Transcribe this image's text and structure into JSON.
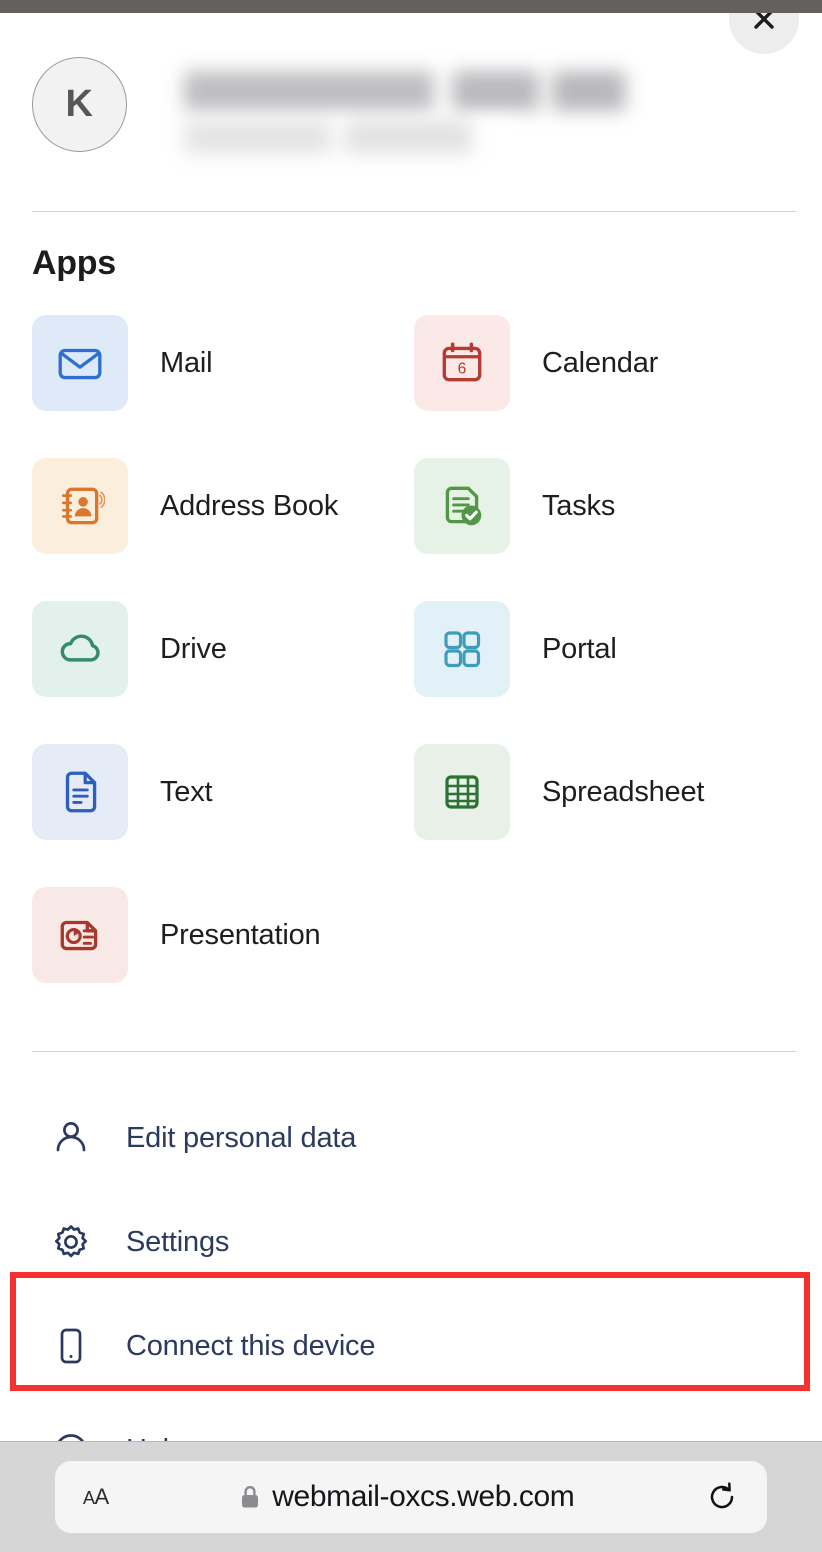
{
  "window": {
    "status_bar_color": "#636160",
    "close_button": {
      "icon": "close-icon",
      "label": "Close"
    }
  },
  "account": {
    "avatar_initial": "K",
    "name_redacted": true,
    "email_redacted": true
  },
  "apps_section": {
    "heading": "Apps",
    "items": [
      {
        "label": "Mail",
        "icon": "mail-envelope-icon",
        "tile_bg": "#dfeaf8",
        "icon_color": "#2f6fd0"
      },
      {
        "label": "Calendar",
        "icon": "calendar-icon",
        "tile_bg": "#fae9e7",
        "icon_color": "#b53a32",
        "badge": "6"
      },
      {
        "label": "Address Book",
        "icon": "address-book-icon",
        "tile_bg": "#fbeedd",
        "icon_color": "#d9782c"
      },
      {
        "label": "Tasks",
        "icon": "tasks-check-icon",
        "tile_bg": "#e6f2e5",
        "icon_color": "#539645"
      },
      {
        "label": "Drive",
        "icon": "cloud-drive-icon",
        "tile_bg": "#e2f1ec",
        "icon_color": "#368a6d"
      },
      {
        "label": "Portal",
        "icon": "grid-squares-icon",
        "tile_bg": "#e2f0f7",
        "icon_color": "#3f9cba"
      },
      {
        "label": "Text",
        "icon": "text-document-icon",
        "tile_bg": "#e6ecf7",
        "icon_color": "#2f5fbd"
      },
      {
        "label": "Spreadsheet",
        "icon": "spreadsheet-table-icon",
        "tile_bg": "#e8f0e8",
        "icon_color": "#2b7234"
      },
      {
        "label": "Presentation",
        "icon": "presentation-chart-icon",
        "tile_bg": "#f8e9e7",
        "icon_color": "#a8372e"
      }
    ]
  },
  "menu": {
    "text_color": "#2b3a5e",
    "items": [
      {
        "label": "Edit personal data",
        "icon": "person-icon",
        "highlighted": false
      },
      {
        "label": "Settings",
        "icon": "gear-icon",
        "highlighted": false
      },
      {
        "label": "Connect this device",
        "icon": "mobile-phone-icon",
        "highlighted": true
      },
      {
        "label": "Help",
        "icon": "question-mark-circle-icon",
        "highlighted": false
      }
    ]
  },
  "highlight": {
    "color": "#f5312e",
    "target": "Connect this device"
  },
  "browser_bar": {
    "text_size_button": "AA",
    "lock_icon": "lock-icon",
    "url": "webmail-oxcs.web.com",
    "reload_icon": "reload-icon"
  }
}
